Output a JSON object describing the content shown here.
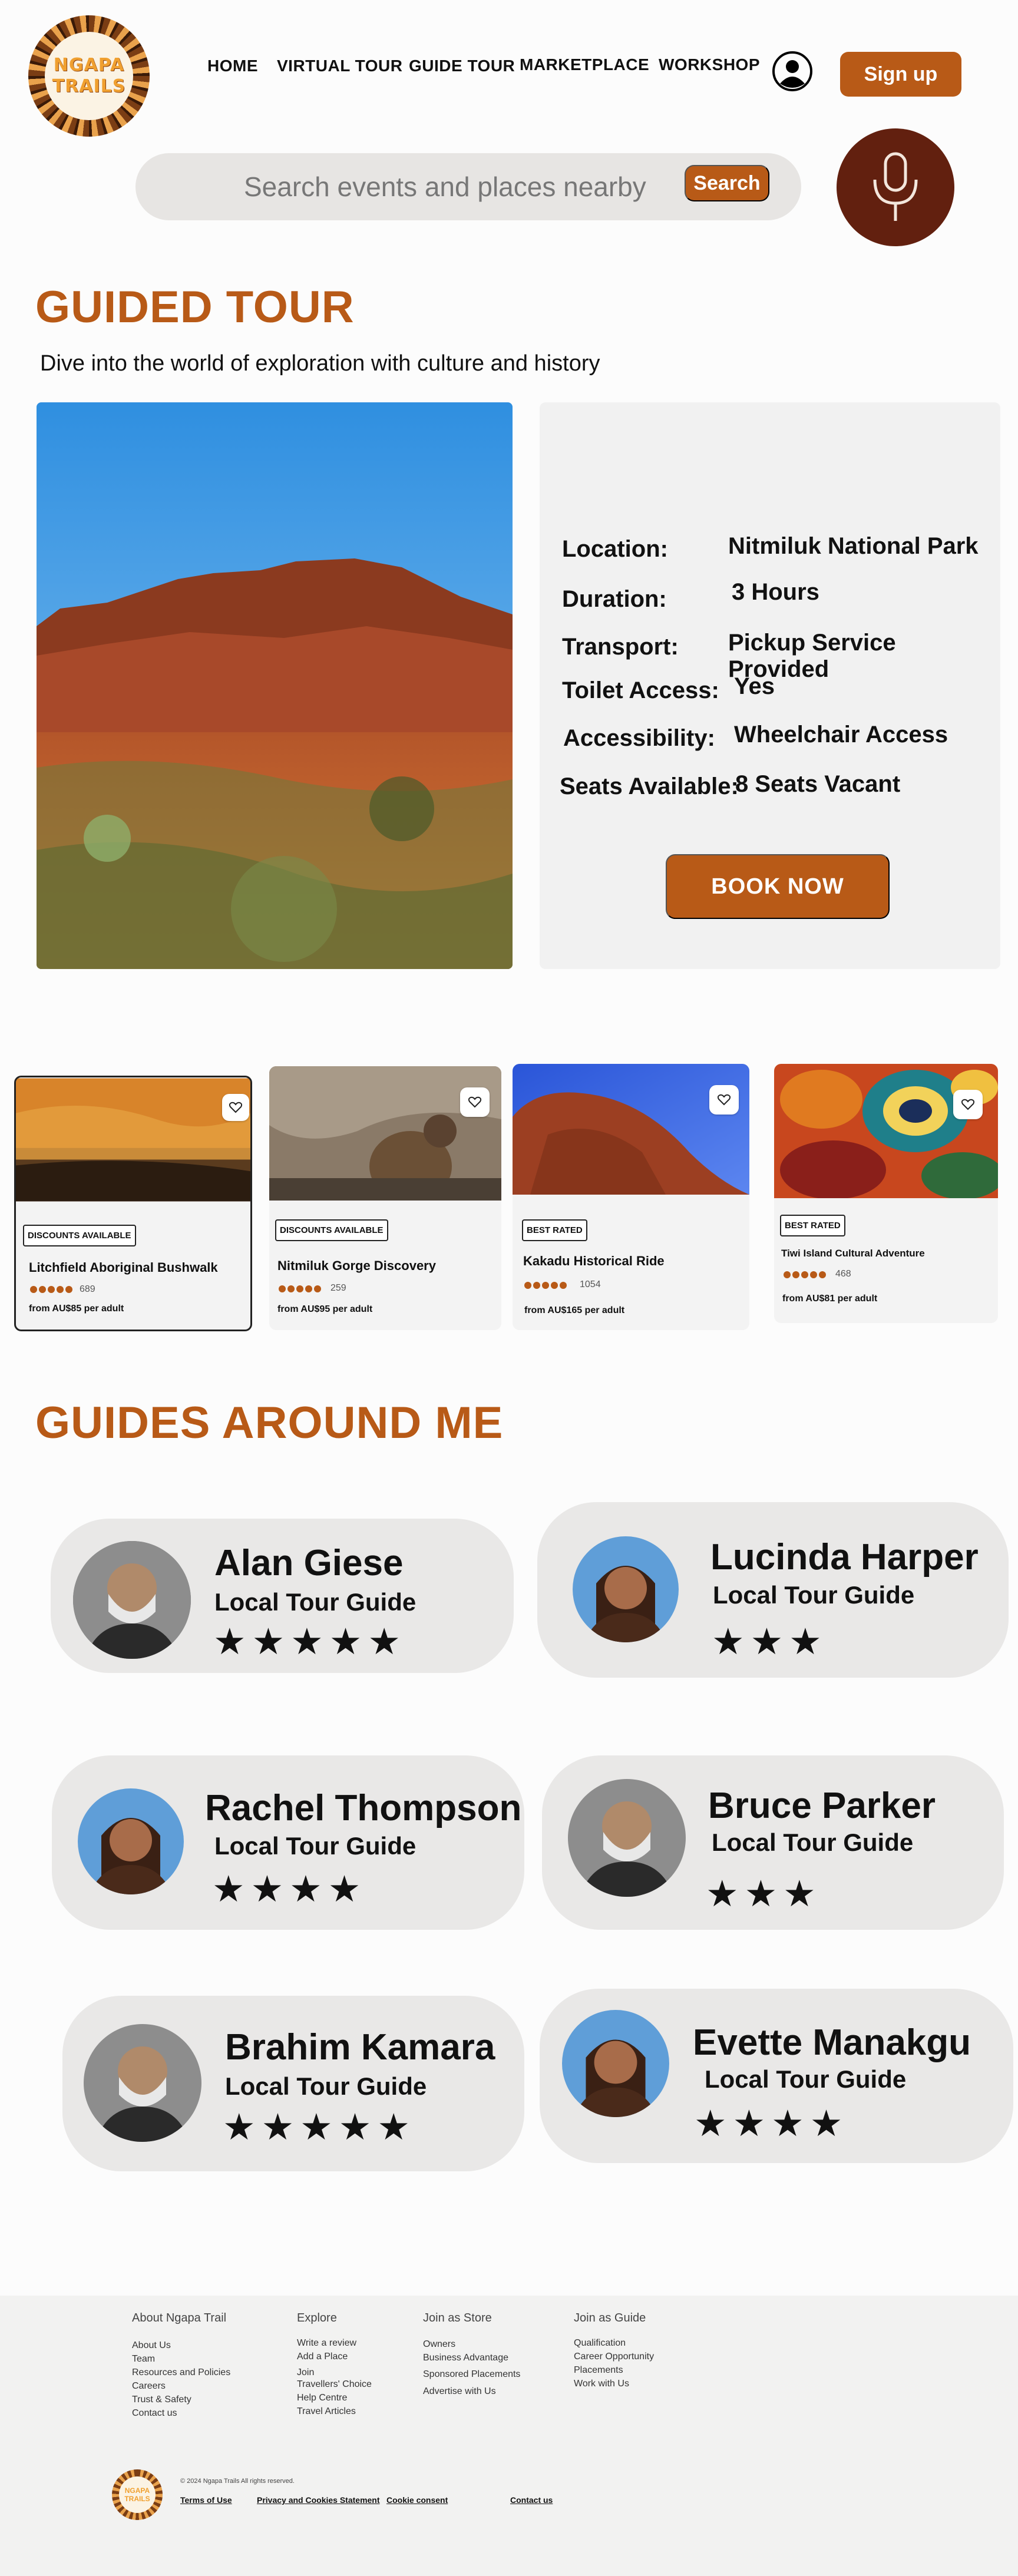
{
  "brand": {
    "logo_line1": "NGAPA",
    "logo_line2": "TRAILS",
    "accent": "#b85a17",
    "mic_bg": "#62200f"
  },
  "nav": [
    "HOME",
    "VIRTUAL TOUR",
    "GUIDE TOUR",
    "MARKETPLACE",
    "WORKSHOP"
  ],
  "header": {
    "signup_label": "Sign up",
    "user_icon": "user-circle-icon"
  },
  "search": {
    "placeholder": "Search events and places nearby",
    "button_label": "Search",
    "mic_icon": "microphone-icon"
  },
  "guided_tour": {
    "title": "GUIDED TOUR",
    "subtitle": "Dive into the world of exploration with culture and history",
    "details": [
      {
        "label": "Location:",
        "value": "Nitmiluk National Park"
      },
      {
        "label": "Duration:",
        "value": "3 Hours"
      },
      {
        "label": "Transport:",
        "value": "Pickup Service Provided"
      },
      {
        "label": "Toilet Access:",
        "value": "Yes"
      },
      {
        "label": "Accessibility:",
        "value": "Wheelchair Access"
      },
      {
        "label": "Seats Available:",
        "value": "8 Seats Vacant"
      }
    ],
    "book_label": "BOOK NOW"
  },
  "tour_cards": [
    {
      "badge": "DISCOUNTS AVAILABLE",
      "name": "Litchfield Aboriginal Bushwalk",
      "rating": 5,
      "reviews": "689",
      "price": "from AU$85 per adult"
    },
    {
      "badge": "DISCOUNTS AVAILABLE",
      "name": "Nitmiluk Gorge Discovery",
      "rating": 5,
      "reviews": "259",
      "price": "from AU$95 per adult"
    },
    {
      "badge": "BEST RATED",
      "name": "Kakadu Historical Ride",
      "rating": 5,
      "reviews": "1054",
      "price": "from AU$165 per adult"
    },
    {
      "badge": "BEST RATED",
      "name": "Tiwi Island Cultural Adventure",
      "rating": 5,
      "reviews": "468",
      "price": "from AU$81 per adult"
    }
  ],
  "guides_section": {
    "title": "GUIDES AROUND ME"
  },
  "guides": [
    {
      "name": "Alan Giese",
      "role": "Local Tour Guide",
      "stars": 5,
      "stars_text": "★★★★★"
    },
    {
      "name": "Lucinda Harper",
      "role": "Local Tour Guide",
      "stars": 3,
      "stars_text": "★★★"
    },
    {
      "name": "Rachel Thompson",
      "role": "Local Tour Guide",
      "stars": 4,
      "stars_text": "★★★★"
    },
    {
      "name": "Bruce Parker",
      "role": "Local Tour Guide",
      "stars": 3,
      "stars_text": "★★★"
    },
    {
      "name": "Brahim Kamara",
      "role": "Local Tour Guide",
      "stars": 5,
      "stars_text": "★★★★★"
    },
    {
      "name": "Evette Manakgu",
      "role": "Local Tour Guide",
      "stars": 4,
      "stars_text": "★★★★"
    }
  ],
  "footer": {
    "columns": [
      {
        "heading": "About Ngapa Trail",
        "links": [
          "About Us",
          "Team",
          "Resources and Policies",
          "Careers",
          "Trust & Safety",
          "Contact us"
        ]
      },
      {
        "heading": "Explore",
        "links": [
          "Write a review",
          "Add a Place",
          "Join",
          "Travellers' Choice",
          "Help Centre",
          "Travel Articles"
        ]
      },
      {
        "heading": "Join as Store",
        "links": [
          "Owners",
          "Business Advantage",
          "Sponsored Placements",
          "Advertise with Us"
        ]
      },
      {
        "heading": "Join as Guide",
        "links": [
          "Qualification",
          "Career Opportunity",
          "Placements",
          "Work with Us"
        ]
      }
    ],
    "copyright": "© 2024 Ngapa Trails All rights reserved.",
    "bottom_links": [
      "Terms of Use",
      "Privacy and Cookies Statement",
      "Cookie consent",
      "Contact us"
    ]
  }
}
